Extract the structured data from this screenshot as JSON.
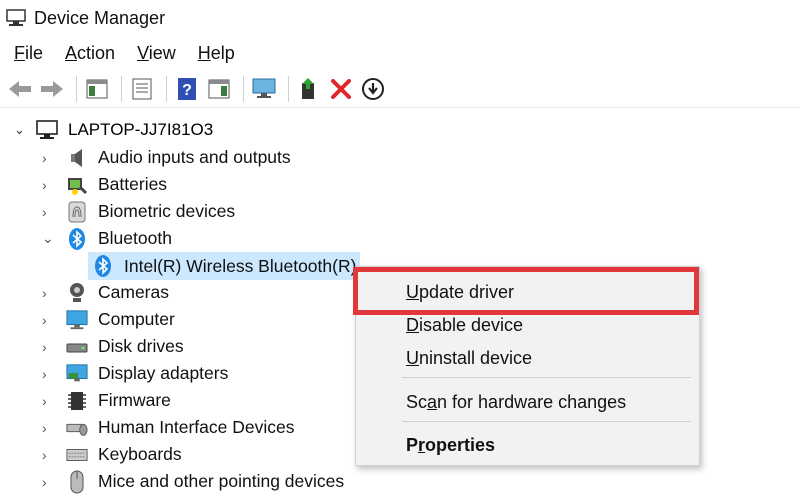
{
  "window": {
    "title": "Device Manager"
  },
  "menubar": [
    {
      "mnemonic": "F",
      "rest": "ile"
    },
    {
      "mnemonic": "A",
      "rest": "ction"
    },
    {
      "mnemonic": "V",
      "rest": "iew"
    },
    {
      "mnemonic": "H",
      "rest": "elp"
    }
  ],
  "toolbar": {
    "buttons": [
      "back-icon",
      "forward-icon",
      "show-hide-console-tree-icon",
      "properties-icon",
      "help-icon",
      "action-pane-icon",
      "scan-hardware-icon",
      "update-driver-icon",
      "uninstall-icon",
      "disable-icon"
    ]
  },
  "tree": {
    "root": {
      "label": "LAPTOP-JJ7I81O3",
      "expanded": true
    },
    "categories": [
      {
        "label": "Audio inputs and outputs",
        "icon": "speaker-icon"
      },
      {
        "label": "Batteries",
        "icon": "battery-icon"
      },
      {
        "label": "Biometric devices",
        "icon": "fingerprint-icon"
      },
      {
        "label": "Bluetooth",
        "icon": "bluetooth-icon",
        "expanded": true
      },
      {
        "label": "Cameras",
        "icon": "camera-icon"
      },
      {
        "label": "Computer",
        "icon": "monitor-icon"
      },
      {
        "label": "Disk drives",
        "icon": "disk-drive-icon"
      },
      {
        "label": "Display adapters",
        "icon": "display-adapter-icon"
      },
      {
        "label": "Firmware",
        "icon": "firmware-icon"
      },
      {
        "label": "Human Interface Devices",
        "icon": "hid-icon"
      },
      {
        "label": "Keyboards",
        "icon": "keyboard-icon"
      },
      {
        "label": "Mice and other pointing devices",
        "icon": "mouse-icon"
      }
    ],
    "selected_child": {
      "label": "Intel(R) Wireless Bluetooth(R)",
      "icon": "bluetooth-icon"
    }
  },
  "context_menu": {
    "update_driver": {
      "mnemonic": "U",
      "rest": "pdate driver"
    },
    "disable_device": {
      "mnemonic": "D",
      "rest": "isable device"
    },
    "uninstall_device": {
      "mnemonic": "U",
      "rest": "ninstall device"
    },
    "scan_hardware": {
      "pre": "Sc",
      "mnemonic": "a",
      "rest": "n for hardware changes"
    },
    "properties": {
      "pre": "P",
      "mnemonic": "r",
      "rest": "operties"
    }
  },
  "colors": {
    "selection": "#cce8ff",
    "highlight_box": "#e0383b",
    "menu_bg": "#f2f2f2",
    "bluetooth": "#1e88e5"
  }
}
